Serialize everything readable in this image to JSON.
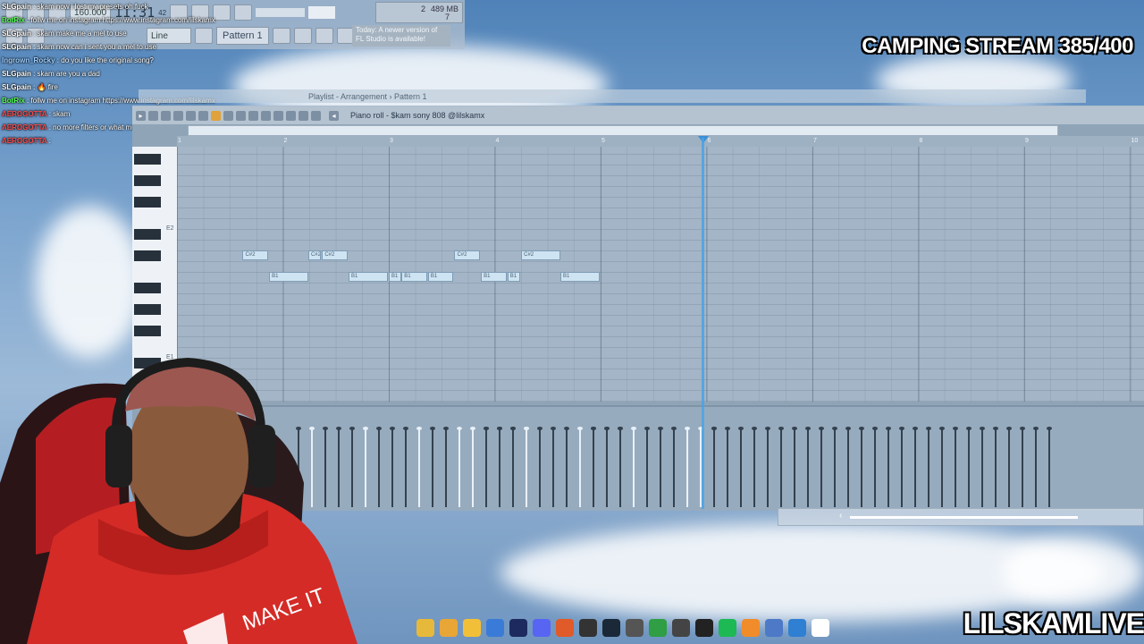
{
  "toolbar": {
    "time": "11:31",
    "time_sub": "42",
    "memory": "489 MB",
    "cpu_top": "2",
    "cpu_bottom": "7",
    "snap": "Line",
    "pattern": "Pattern 1",
    "hint": "Today: A newer version of FL Studio is available!",
    "tempo": "160.000"
  },
  "chat": [
    {
      "user": "SLGpain",
      "text": ": skam now i lost my presets oh fuck",
      "color": "#ffffff"
    },
    {
      "user": "BotRix",
      "text": ": follw me on instagram https://www.instagram.com/lilskamx",
      "color": "#55ff55"
    },
    {
      "user": "SLGpain",
      "text": ": skam make me a mel to use",
      "color": "#ffffff"
    },
    {
      "user": "SLGpain",
      "text": ": skam now can i sent you a mel to use",
      "color": "#ffffff"
    },
    {
      "user": "Ingrown_Rocky",
      "text": ": do you like the original song?",
      "color": "#9fd0ff"
    },
    {
      "user": "SLGpain",
      "text": ": skam are you a dad",
      "color": "#ffffff"
    },
    {
      "user": "SLGpain",
      "text": ": 🔥 fire",
      "color": "#ffffff"
    },
    {
      "user": "BotRix",
      "text": ": follw me on instagram https://www.instagram.com/lilskamx",
      "color": "#55ff55"
    },
    {
      "user": "AEROGOTTA",
      "text": ": skam",
      "color": "#ff4a4a"
    },
    {
      "user": "AEROGOTTA",
      "text": ": no more filters or what mud",
      "color": "#ff4a4a"
    },
    {
      "user": "AEROGOTTA",
      "text": ":",
      "color": "#ff4a4a"
    }
  ],
  "overlay": {
    "stream_title": "CAMPING STREAM 385/400",
    "channel": "LILSKAMLIVE"
  },
  "playlist": {
    "title": "Playlist - Arrangement › Pattern 1"
  },
  "piano_roll": {
    "title": "Piano roll - $kam sony 808 @lilskamx",
    "bars": [
      "1",
      "2",
      "3",
      "4",
      "5",
      "6",
      "7",
      "8",
      "9",
      "10"
    ],
    "octave_labels": [
      "E2",
      "E1"
    ],
    "notes": [
      {
        "label": "C#2",
        "row": "c",
        "start": 1.62,
        "len": 0.24
      },
      {
        "label": "B1",
        "row": "b",
        "start": 1.87,
        "len": 0.37
      },
      {
        "label": "C#2",
        "row": "c",
        "start": 2.24,
        "len": 0.12
      },
      {
        "label": "C#2",
        "row": "c",
        "start": 2.37,
        "len": 0.24
      },
      {
        "label": "B1",
        "row": "b",
        "start": 2.62,
        "len": 0.37
      },
      {
        "label": "B1",
        "row": "b",
        "start": 3.0,
        "len": 0.12
      },
      {
        "label": "B1",
        "row": "b",
        "start": 3.12,
        "len": 0.24
      },
      {
        "label": "B1",
        "row": "b",
        "start": 3.37,
        "len": 0.24
      },
      {
        "label": "C#2",
        "row": "c",
        "start": 3.62,
        "len": 0.24
      },
      {
        "label": "B1",
        "row": "b",
        "start": 3.87,
        "len": 0.24
      },
      {
        "label": "B1",
        "row": "b",
        "start": 4.12,
        "len": 0.12
      },
      {
        "label": "C#2",
        "row": "c",
        "start": 4.25,
        "len": 0.37
      },
      {
        "label": "B1",
        "row": "b",
        "start": 4.62,
        "len": 0.37
      }
    ],
    "playhead_bar": 5.95
  },
  "taskbar": {
    "icons": [
      "folder-icon",
      "chrome-icon",
      "files-icon",
      "store-icon",
      "photoshop-icon",
      "discord-icon",
      "brave-icon",
      "obs-icon",
      "steam-icon",
      "keyboard-icon",
      "android-icon",
      "4k-icon",
      "capcut-icon",
      "spotify-icon",
      "fl-studio-icon",
      "notes-icon",
      "window-icon",
      "file-icon"
    ]
  }
}
